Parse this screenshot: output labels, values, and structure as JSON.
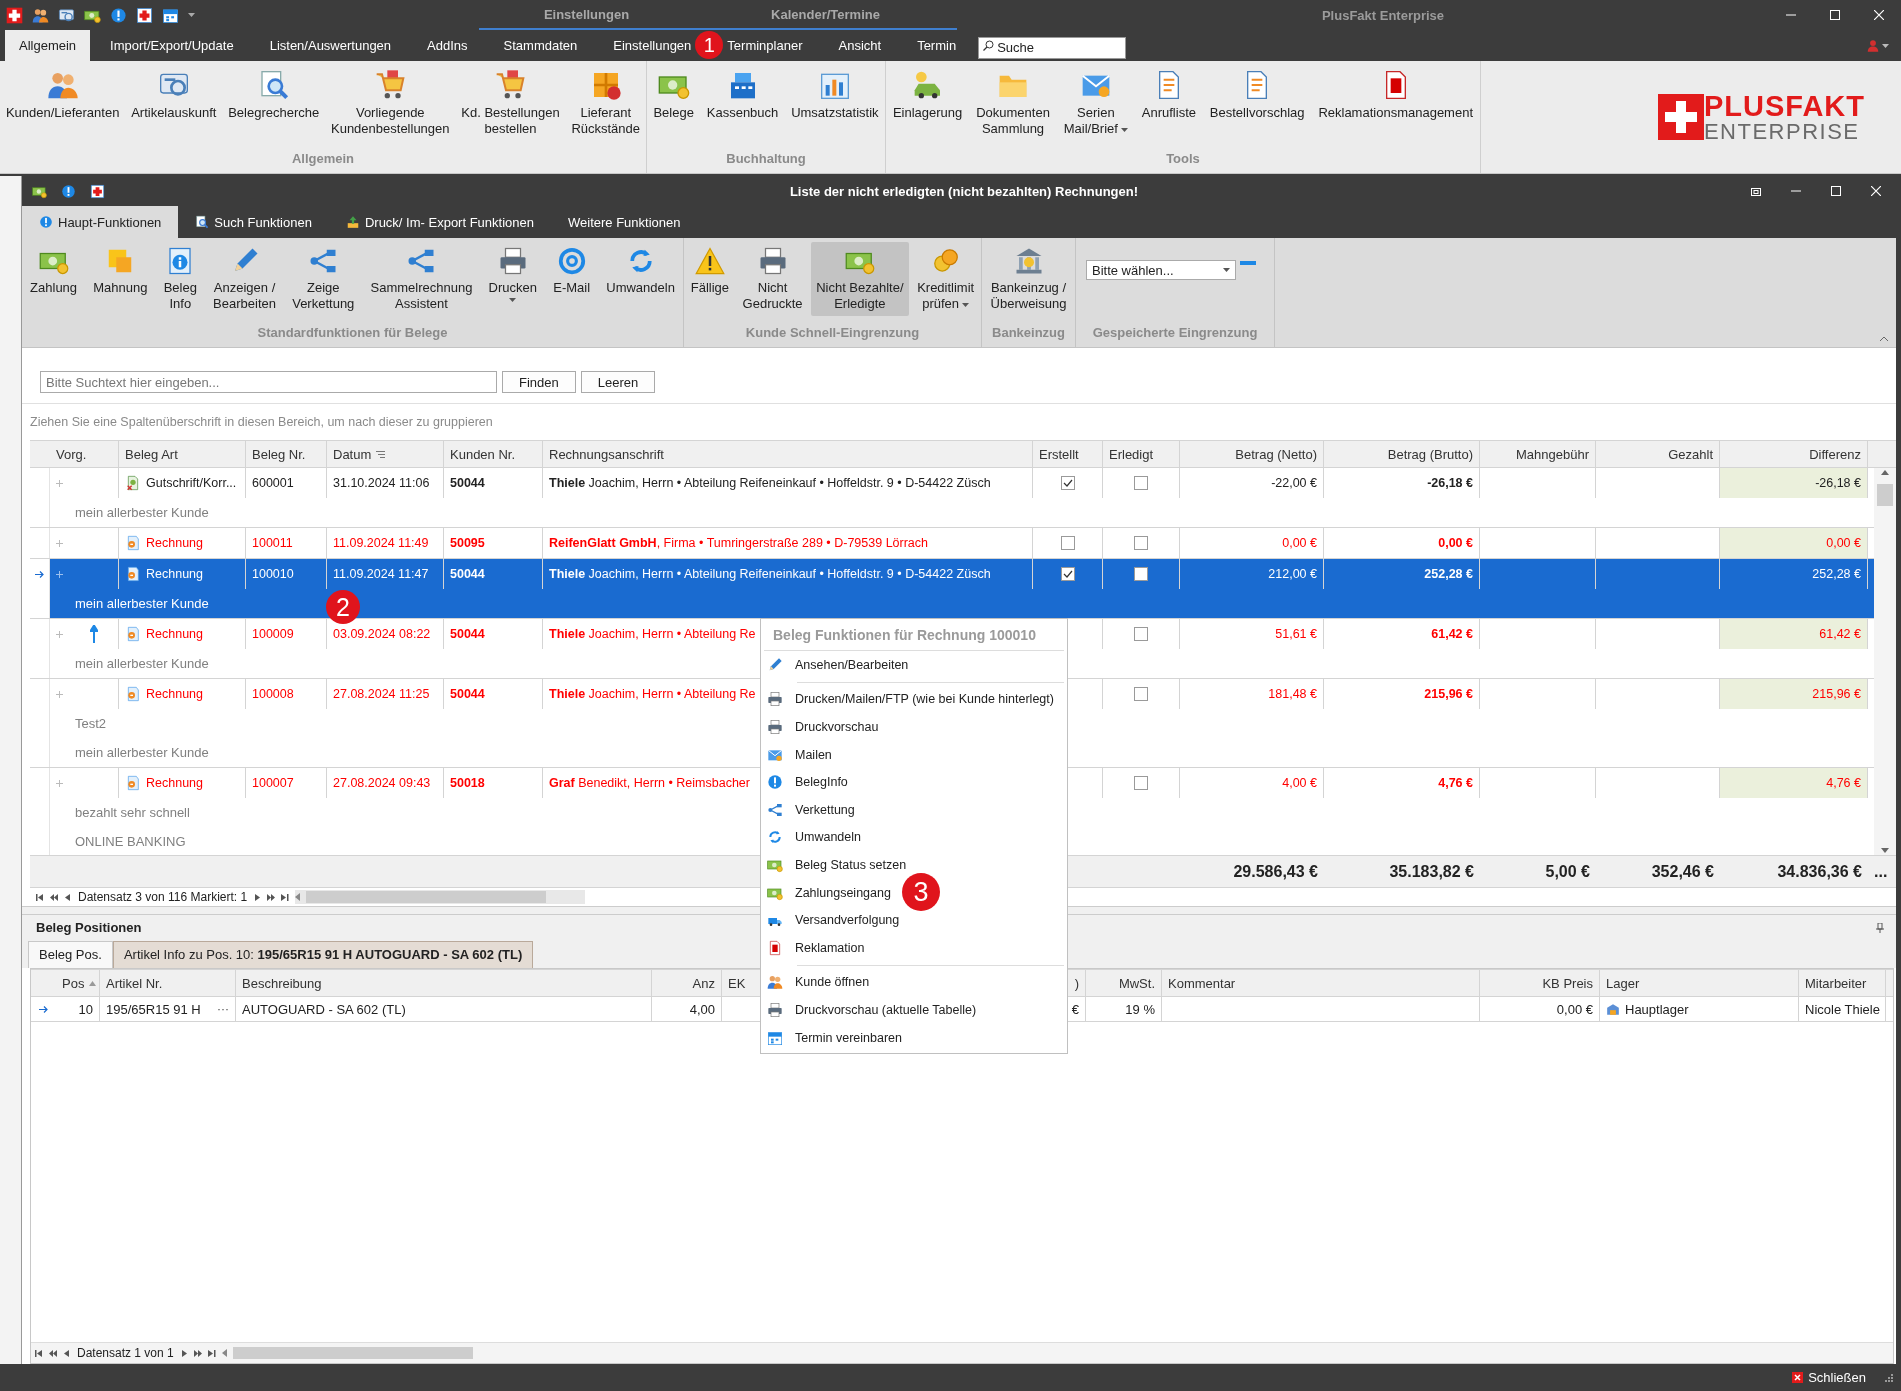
{
  "title_bar": {
    "context_tabs": [
      {
        "label": "Einstellungen"
      },
      {
        "label": "Kalender/Termine"
      }
    ],
    "title": "PlusFakt Enterprise"
  },
  "ribbon": {
    "tabs": [
      {
        "label": "Allgemein",
        "selected": true
      },
      {
        "label": "Import/Export/Update",
        "selected": false
      },
      {
        "label": "Listen/Auswertungen",
        "selected": false
      },
      {
        "label": "AddIns",
        "selected": false
      },
      {
        "label": "Stammdaten",
        "selected": false
      },
      {
        "label": "Einstellungen",
        "selected": false
      },
      {
        "label": "Terminplaner",
        "selected": false
      },
      {
        "label": "Ansicht",
        "selected": false
      },
      {
        "label": "Termin",
        "selected": false
      }
    ],
    "search": {
      "placeholder": "Suche"
    },
    "groups": [
      {
        "label": "Allgemein",
        "buttons": [
          {
            "label": "Kunden/Lieferanten",
            "dropdown": false
          },
          {
            "label": "Artikelauskunft",
            "dropdown": false
          },
          {
            "label": "Belegrecherche",
            "dropdown": false
          },
          {
            "label": "Vorliegende\nKundenbestellungen",
            "dropdown": false
          },
          {
            "label": "Kd. Bestellungen\nbestellen",
            "dropdown": false
          },
          {
            "label": "Lieferant\nRückstände",
            "dropdown": false
          }
        ]
      },
      {
        "label": "Buchhaltung",
        "buttons": [
          {
            "label": "Belege",
            "dropdown": false
          },
          {
            "label": "Kassenbuch",
            "dropdown": false
          },
          {
            "label": "Umsatzstatistik",
            "dropdown": false
          }
        ]
      },
      {
        "label": "Tools",
        "buttons": [
          {
            "label": "Einlagerung",
            "dropdown": false
          },
          {
            "label": "Dokumenten\nSammlung",
            "dropdown": false
          },
          {
            "label": "Serien\nMail/Brief",
            "dropdown": true
          },
          {
            "label": "Anrufliste",
            "dropdown": false
          },
          {
            "label": "Bestellvorschlag",
            "dropdown": false
          },
          {
            "label": "Reklamationsmanagement",
            "dropdown": false
          }
        ]
      }
    ],
    "logo": {
      "brand": "PLUSFAKT",
      "edition": "ENTERPRISE"
    }
  },
  "window": {
    "title": "Liste der nicht erledigten (nicht bezahlten) Rechnungen!",
    "tabs": [
      {
        "label": "Haupt-Funktionen",
        "selected": true
      },
      {
        "label": "Such Funktionen",
        "selected": false
      },
      {
        "label": "Druck/ Im- Export Funktionen",
        "selected": false
      },
      {
        "label": "Weitere Funktionen",
        "selected": false
      }
    ],
    "ribbon_groups": [
      {
        "label": "Standardfunktionen für Belege",
        "kind": "buttons",
        "buttons": [
          {
            "label": "Zahlung",
            "dropdown": false,
            "pressed": false
          },
          {
            "label": "Mahnung",
            "dropdown": false,
            "pressed": false
          },
          {
            "label": "Beleg\nInfo",
            "dropdown": false,
            "pressed": false
          },
          {
            "label": "Anzeigen /\nBearbeiten",
            "dropdown": false,
            "pressed": false
          },
          {
            "label": "Zeige\nVerkettung",
            "dropdown": false,
            "pressed": false
          },
          {
            "label": "Sammelrechnung\nAssistent",
            "dropdown": false,
            "pressed": false
          },
          {
            "label": "Drucken",
            "dropdown": true,
            "pressed": false
          },
          {
            "label": "E-Mail",
            "dropdown": false,
            "pressed": false
          },
          {
            "label": "Umwandeln",
            "dropdown": false,
            "pressed": false
          }
        ]
      },
      {
        "label": "Kunde Schnell-Eingrenzung",
        "kind": "buttons",
        "buttons": [
          {
            "label": "Fällige",
            "dropdown": false,
            "pressed": false
          },
          {
            "label": "Nicht\nGedruckte",
            "dropdown": false,
            "pressed": false
          },
          {
            "label": "Nicht Bezahlte/\nErledigte",
            "dropdown": false,
            "pressed": true
          },
          {
            "label": "Kreditlimit\nprüfen",
            "dropdown": true,
            "pressed": false
          }
        ]
      },
      {
        "label": "Bankeinzug",
        "kind": "buttons",
        "buttons": [
          {
            "label": "Bankeinzug /\nÜberweisung",
            "dropdown": false,
            "pressed": false
          }
        ]
      },
      {
        "label": "Gespeicherte Eingrenzung",
        "kind": "select",
        "value": "Bitte wählen..."
      }
    ],
    "search": {
      "placeholder": "Bitte Suchtext hier eingeben...",
      "buttons": [
        "Finden",
        "Leeren"
      ]
    },
    "group_panel": "Ziehen Sie eine Spaltenüberschrift in diesen Bereich, um nach dieser zu gruppieren",
    "table": {
      "columns": [
        {
          "label": "Vorg.",
          "kind": "tree",
          "sorted": false
        },
        {
          "label": "Beleg Art",
          "kind": "doc",
          "sorted": false
        },
        {
          "label": "Beleg Nr.",
          "kind": "text",
          "sorted": false
        },
        {
          "label": "Datum",
          "kind": "text",
          "sorted": true
        },
        {
          "label": "Kunden Nr.",
          "kind": "strong",
          "sorted": false
        },
        {
          "label": "Rechnungsanschrift",
          "kind": "rich",
          "sorted": false
        },
        {
          "label": "Erstellt",
          "kind": "check",
          "sorted": false
        },
        {
          "label": "Erledigt",
          "kind": "check",
          "sorted": false
        },
        {
          "label": "Betrag (Netto)",
          "kind": "amount",
          "sorted": false
        },
        {
          "label": "Betrag (Brutto)",
          "kind": "strong_amount",
          "sorted": false
        },
        {
          "label": "Mahngebühr",
          "kind": "amount",
          "sorted": false
        },
        {
          "label": "Gezahlt",
          "kind": "amount",
          "sorted": false
        },
        {
          "label": "Differenz",
          "kind": "balance",
          "sorted": false
        }
      ],
      "rows": [
        {
          "kind": "credit",
          "selected": false,
          "overdue": false,
          "linked": false,
          "cells": [
            null,
            "Gutschrift/Korr...",
            "600001",
            "31.10.2024 11:06",
            "50044",
            "**Thiele** Joachim, Herrn • Abteilung Reifeneinkauf • Hoffeldstr. 9 • D-54422 Züsch",
            true,
            false,
            "-22,00 €",
            "-26,18 €",
            null,
            null,
            "-26,18 €"
          ],
          "notes": [
            "mein allerbester Kunde"
          ]
        },
        {
          "kind": "invoice",
          "selected": false,
          "overdue": true,
          "linked": false,
          "cells": [
            null,
            "Rechnung",
            "100011",
            "11.09.2024 11:49",
            "50095",
            "**ReifenGlatt GmbH**, Firma • Tumringerstraße 289 • D-79539 Lörrach",
            false,
            false,
            "0,00 €",
            "0,00 €",
            null,
            null,
            "0,00 €"
          ],
          "notes": []
        },
        {
          "kind": "invoice",
          "selected": true,
          "overdue": true,
          "linked": false,
          "cells": [
            null,
            "Rechnung",
            "100010",
            "11.09.2024 11:47",
            "50044",
            "**Thiele** Joachim, Herrn • Abteilung Reifeneinkauf • Hoffeldstr. 9 • D-54422 Züsch",
            true,
            false,
            "212,00 €",
            "252,28 €",
            null,
            null,
            "252,28 €"
          ],
          "notes": [
            "mein allerbester Kunde"
          ]
        },
        {
          "kind": "invoice",
          "selected": false,
          "overdue": true,
          "linked": true,
          "cells": [
            null,
            "Rechnung",
            "100009",
            "03.09.2024 08:22",
            "50044",
            "**Thiele** Joachim, Herrn • Abteilung Re",
            null,
            false,
            "51,61 €",
            "61,42 €",
            null,
            null,
            "61,42 €"
          ],
          "notes": [
            "mein allerbester Kunde"
          ]
        },
        {
          "kind": "invoice",
          "selected": false,
          "overdue": true,
          "linked": false,
          "cells": [
            null,
            "Rechnung",
            "100008",
            "27.08.2024 11:25",
            "50044",
            "**Thiele** Joachim, Herrn • Abteilung Re",
            null,
            false,
            "181,48 €",
            "215,96 €",
            null,
            null,
            "215,96 €"
          ],
          "notes": [
            "Test2",
            "mein allerbester Kunde"
          ]
        },
        {
          "kind": "invoice",
          "selected": false,
          "overdue": true,
          "linked": false,
          "cells": [
            null,
            "Rechnung",
            "100007",
            "27.08.2024 09:43",
            "50018",
            "**Graf** Benedikt, Herrn • Reimsbacher",
            null,
            false,
            "4,00 €",
            "4,76 €",
            null,
            null,
            "4,76 €"
          ],
          "notes": [
            "bezahlt sehr schnell",
            "ONLINE BANKING"
          ]
        }
      ],
      "totals": [
        "29.586,43 €",
        "35.183,82 €",
        "5,00 €",
        "352,46 €",
        "34.836,36 €"
      ],
      "totals_more": "...",
      "navigator": "Datensatz 3 von 116 Markiert: 1"
    },
    "detail": {
      "title": "Beleg Positionen",
      "tabs": [
        {
          "label": "Beleg Pos.",
          "selected": true
        },
        {
          "label": "Artikel Info zu Pos. 10: **195/65R15 91 H AUTOGUARD - SA 602 (TL)**",
          "selected": false
        }
      ],
      "columns": [
        {
          "label": "Pos",
          "kind": "number",
          "sorted": true
        },
        {
          "label": "Artikel Nr.",
          "kind": "lookup",
          "sorted": false
        },
        {
          "label": "Beschreibung",
          "kind": "text",
          "sorted": false
        },
        {
          "label": "Anz",
          "kind": "number",
          "sorted": false
        },
        {
          "label": "EK",
          "kind": "text",
          "sorted": false
        },
        {
          "label": ")",
          "kind": "number",
          "sorted": false
        },
        {
          "label": "MwSt.",
          "kind": "number",
          "sorted": false
        },
        {
          "label": "Kommentar",
          "kind": "text",
          "sorted": false
        },
        {
          "label": "KB Preis",
          "kind": "number",
          "sorted": false
        },
        {
          "label": "Lager",
          "kind": "store",
          "sorted": false
        },
        {
          "label": "Mitarbeiter",
          "kind": "text",
          "sorted": false
        }
      ],
      "rows": [
        {
          "selected": true,
          "lookup_button": "···",
          "cells": [
            "10",
            "195/65R15 91 H",
            "AUTOGUARD - SA 602 (TL)",
            "4,00",
            null,
            "€",
            "19 %",
            null,
            "0,00 €",
            "Hauptlager",
            "Nicole Thiele"
          ]
        }
      ],
      "navigator": "Datensatz 1 von 1"
    }
  },
  "context_menu": {
    "title": "Beleg Funktionen für Rechnung 100010",
    "sections": [
      [
        {
          "label": "Ansehen/Bearbeiten"
        }
      ],
      [
        {
          "label": "Drucken/Mailen/FTP (wie bei Kunde hinterlegt)"
        },
        {
          "label": "Druckvorschau"
        },
        {
          "label": "Mailen"
        },
        {
          "label": "BelegInfo"
        },
        {
          "label": "Verkettung"
        },
        {
          "label": "Umwandeln"
        },
        {
          "label": "Beleg Status setzen"
        },
        {
          "label": "Zahlungseingang"
        },
        {
          "label": "Versandverfolgung"
        },
        {
          "label": "Reklamation"
        }
      ],
      [
        {
          "label": "Kunde öffnen"
        },
        {
          "label": "Druckvorschau (aktuelle Tabelle)"
        },
        {
          "label": "Termin vereinbaren"
        }
      ]
    ]
  },
  "callouts": [
    "1",
    "2",
    "3"
  ],
  "status_bar": {
    "close_label": "Schließen"
  }
}
